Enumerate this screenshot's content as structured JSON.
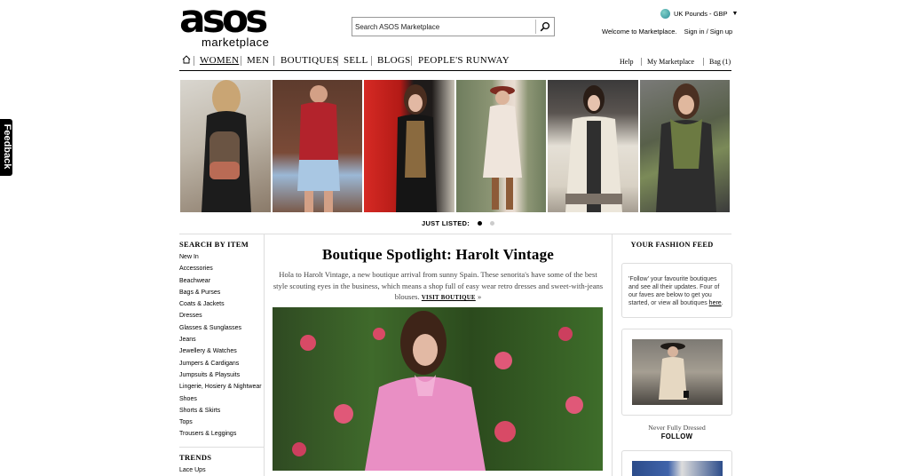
{
  "feedback_tab": {
    "label": "Feedback"
  },
  "header": {
    "logo_word": "asos",
    "logo_sub": "marketplace",
    "search_placeholder": "Search ASOS Marketplace",
    "currency": "UK Pounds - GBP",
    "welcome": "Welcome to Marketplace.",
    "sign_links": "Sign in / Sign up"
  },
  "nav": {
    "items": [
      {
        "label": "WOMEN",
        "active": true
      },
      {
        "label": "MEN"
      },
      {
        "label": "BOUTIQUES"
      },
      {
        "label": "SELL"
      },
      {
        "label": "BLOGS"
      },
      {
        "label": "PEOPLE'S RUNWAY"
      }
    ],
    "help": "Help",
    "my_marketplace": "My Marketplace",
    "bag": "Bag",
    "bag_count": "(1)"
  },
  "carousel": {
    "label": "JUST LISTED:",
    "active_index": 0,
    "dot_count": 2
  },
  "sidebar": {
    "heading": "SEARCH BY ITEM",
    "items": [
      "New In",
      "Accessories",
      "Beachwear",
      "Bags & Purses",
      "Coats & Jackets",
      "Dresses",
      "Glasses & Sunglasses",
      "Jeans",
      "Jewellery & Watches",
      "Jumpers & Cardigans",
      "Jumpsuits & Playsuits",
      "Lingerie, Hosiery & Nightwear",
      "Shoes",
      "Shorts & Skirts",
      "Tops",
      "Trousers & Leggings"
    ],
    "trends_heading": "TRENDS",
    "trends_items": [
      "Lace Ups"
    ]
  },
  "article": {
    "title": "Boutique Spotlight: Harolt Vintage",
    "description": "Hola to Harolt Vintage, a new boutique arrival from sunny Spain. These senorita's have some of the best style scouting eyes in the business, which means a shop full of easy wear retro dresses and sweet-with-jeans blouses.",
    "visit_label": "VISIT BOUTIQUE",
    "visit_suffix": "»"
  },
  "feed": {
    "heading": "YOUR FASHION FEED",
    "intro": "'Follow' your favourite boutiques and see all their updates. Four of our faves are below to get you started, or view all boutiques ",
    "intro_link": "here",
    "intro_end": ".",
    "boutique_name": "Never Fully Dressed",
    "follow_label": "FOLLOW"
  }
}
